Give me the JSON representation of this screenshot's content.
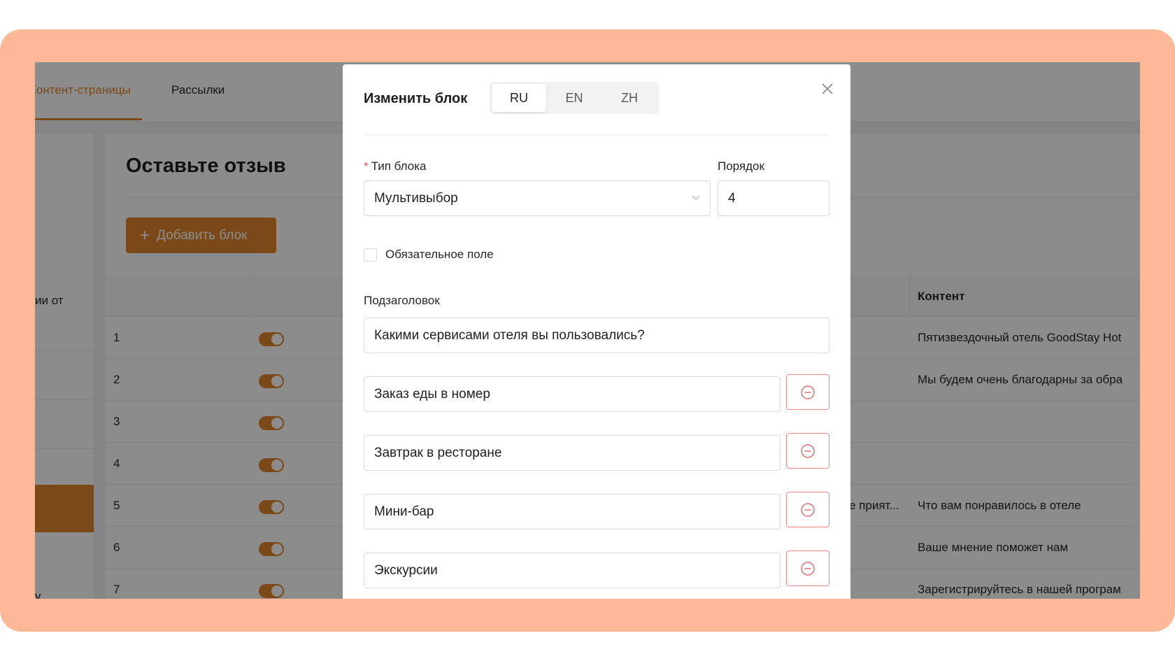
{
  "background": {
    "tabs": [
      {
        "label": "Контент-страницы",
        "active": true
      },
      {
        "label": "Рассылки",
        "active": false
      }
    ],
    "sidebar_texts": [
      "ии от",
      "у"
    ],
    "page_title": "Оставьте отзыв",
    "add_block_label": "Добавить блок",
    "table": {
      "content_header": "Контент",
      "rows": [
        {
          "num": "1",
          "mid": "",
          "content": "Пятизвездочный отель GoodStay Hot"
        },
        {
          "num": "2",
          "mid": "",
          "content": "Мы будем очень благодарны за обра"
        },
        {
          "num": "3",
          "mid": "",
          "content": ""
        },
        {
          "num": "4",
          "mid": "",
          "content": ""
        },
        {
          "num": "5",
          "mid": "е прият...",
          "content": "Что вам понравилось в отеле"
        },
        {
          "num": "6",
          "mid": "",
          "content": "Ваше мнение поможет нам"
        },
        {
          "num": "7",
          "mid": "",
          "content": "Зарегистрируйтесь в нашей програм"
        }
      ]
    }
  },
  "modal": {
    "title": "Изменить блок",
    "languages": [
      {
        "code": "RU",
        "active": true
      },
      {
        "code": "EN",
        "active": false
      },
      {
        "code": "ZH",
        "active": false
      }
    ],
    "block_type_label": "Тип блока",
    "block_type_value": "Мультивыбор",
    "order_label": "Порядок",
    "order_value": "4",
    "required_checkbox_label": "Обязательное поле",
    "required_checked": false,
    "subtitle_label": "Подзаголовок",
    "subtitle_value": "Какими сервисами отеля вы пользовались?",
    "options": [
      "Заказ еды в номер",
      "Завтрак в ресторане",
      "Мини-бар",
      "Экскурсии"
    ]
  },
  "colors": {
    "frame": "#fcb897",
    "accent": "#e0852a",
    "danger": "#e88a88"
  }
}
